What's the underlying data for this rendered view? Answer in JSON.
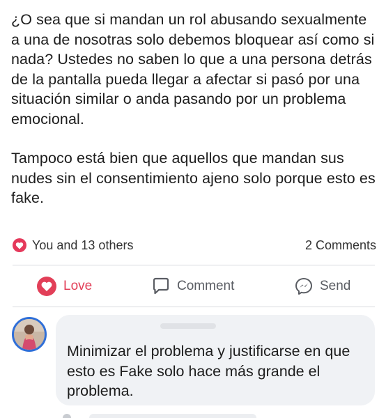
{
  "post": {
    "paragraph_1": "¿O sea que si mandan un rol abusando sexualmente a una de nosotras solo debemos bloquear así como si nada? Ustedes no saben lo que a una persona detrás de la pantalla pueda llegar a afectar si pasó por una situación similar o anda pasando por un problema emocional.",
    "paragraph_2": "Tampoco está bien que aquellos que mandan sus nudes sin el consentimiento ajeno solo porque esto es fake."
  },
  "reactions": {
    "icon": "heart-icon",
    "summary": "You and 13 others",
    "comments_count": "2 Comments"
  },
  "actions": {
    "love_label": "Love",
    "comment_label": "Comment",
    "send_label": "Send"
  },
  "comment": {
    "text": "Minimizar el problema y justificarse en que esto es Fake solo hace más grande el problema."
  },
  "colors": {
    "love_red": "#e23f58",
    "avatar_ring": "#2f6fd8",
    "bubble_bg": "#f0f2f5"
  }
}
